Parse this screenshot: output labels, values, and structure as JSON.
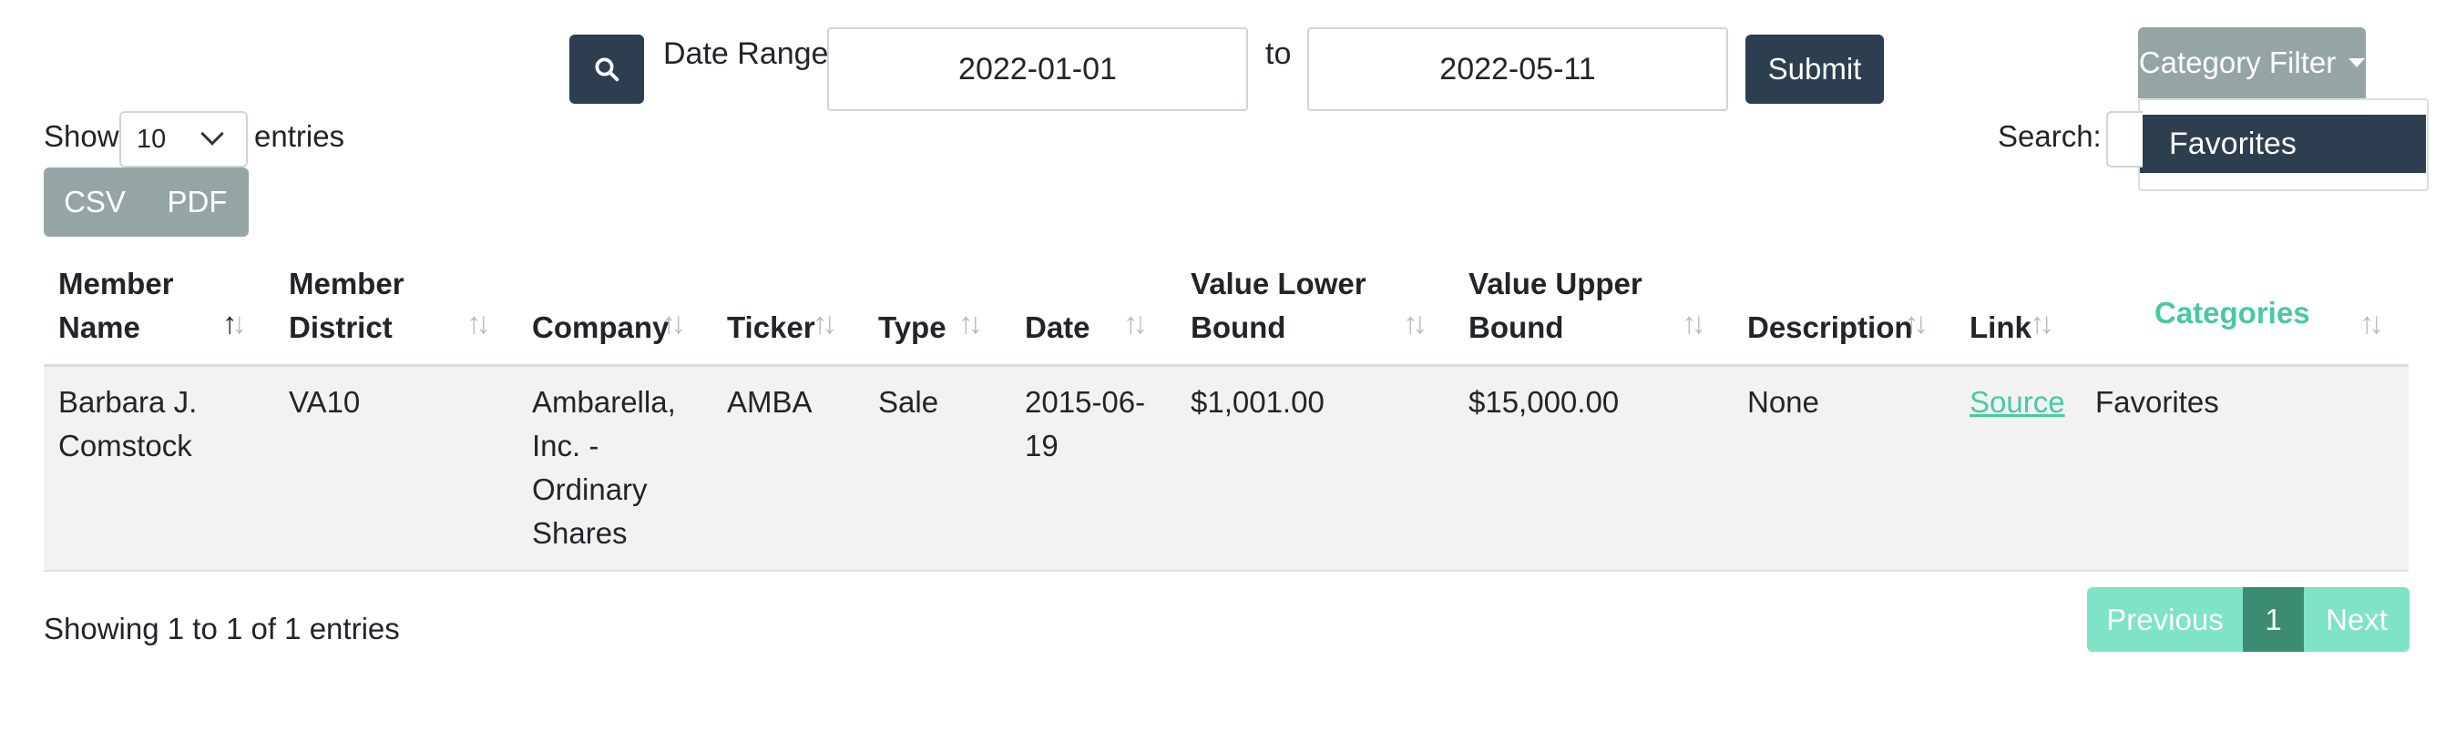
{
  "toolbar": {
    "date_range_label": "Date Range:",
    "start_date": "2022-01-01",
    "to_label": "to",
    "end_date": "2022-05-11",
    "submit_label": "Submit",
    "search_icon": "search-icon"
  },
  "category_filter": {
    "button_label": "Category Filter",
    "items": [
      "Favorites"
    ]
  },
  "length": {
    "show_label": "Show",
    "value": "10",
    "entries_label": "entries"
  },
  "search": {
    "label": "Search:",
    "value": ""
  },
  "export": {
    "csv": "CSV",
    "pdf": "PDF"
  },
  "table": {
    "columns": [
      {
        "label": "Member Name",
        "sort": "asc"
      },
      {
        "label": "Member District",
        "sort": "none"
      },
      {
        "label": "Company",
        "sort": "none"
      },
      {
        "label": "Ticker",
        "sort": "none"
      },
      {
        "label": "Type",
        "sort": "none"
      },
      {
        "label": "Date",
        "sort": "none"
      },
      {
        "label": "Value Lower Bound",
        "sort": "none"
      },
      {
        "label": "Value Upper Bound",
        "sort": "none"
      },
      {
        "label": "Description",
        "sort": "none"
      },
      {
        "label": "Link",
        "sort": "none"
      },
      {
        "label": "Categories",
        "sort": "none"
      }
    ],
    "rows": [
      {
        "member_name": "Barbara J. Comstock",
        "member_district": "VA10",
        "company": "Ambarella, Inc. - Ordinary Shares",
        "ticker": "AMBA",
        "type": "Sale",
        "date": "2015-06-19",
        "value_lower": "$1,001.00",
        "value_upper": "$15,000.00",
        "description": "None",
        "link": "Source",
        "categories": "Favorites"
      }
    ]
  },
  "footer": {
    "info": "Showing 1 to 1 of 1 entries",
    "previous": "Previous",
    "page": "1",
    "next": "Next"
  },
  "colors": {
    "primary": "#2c3e50",
    "secondary": "#95a5a6",
    "accent": "#48c9a3",
    "pagination_light": "#7fe3c7",
    "pagination_active": "#3d8b73"
  }
}
